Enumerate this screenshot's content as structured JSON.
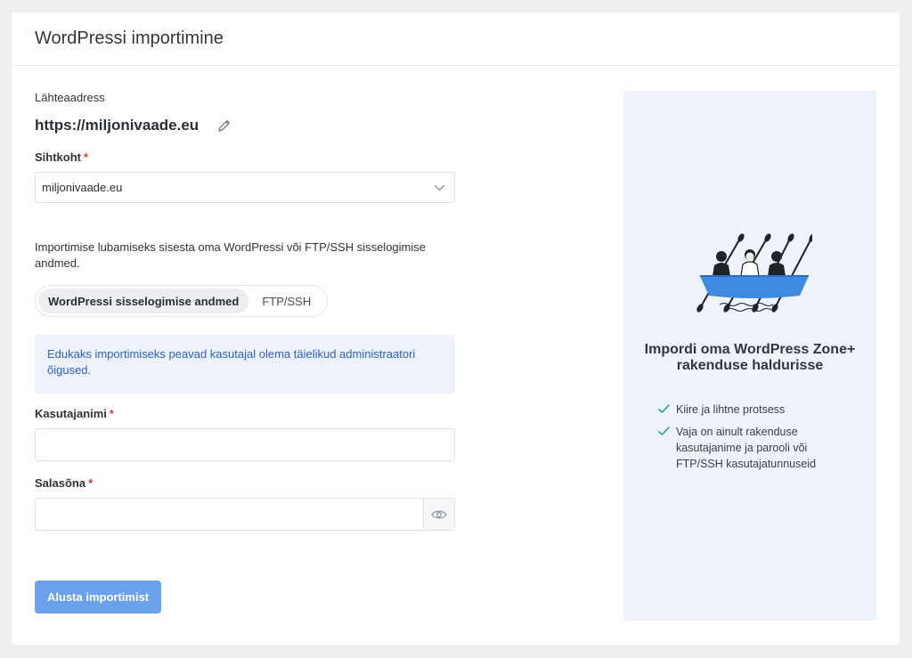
{
  "header": {
    "title": "WordPressi importimine"
  },
  "form": {
    "source_label": "Lähteaadress",
    "source_url": "https://miljonivaade.eu",
    "destination_label": "Sihtkoht",
    "destination_value": "miljonivaade.eu",
    "info_text": "Importimise lubamiseks sisesta oma WordPressi või FTP/SSH sisselogimise andmed.",
    "tabs": [
      {
        "label": "WordPressi sisselogimise andmed",
        "active": true
      },
      {
        "label": "FTP/SSH",
        "active": false
      }
    ],
    "notice": "Edukaks importimiseks peavad kasutajal olema täielikud administraatori õigused.",
    "username_label": "Kasutajanimi",
    "username_value": "",
    "password_label": "Salasõna",
    "password_value": "",
    "required_mark": "*",
    "submit_label": "Alusta importimist"
  },
  "side": {
    "title": "Impordi oma WordPress Zone+ rakenduse haldurisse",
    "features": [
      "Kiire ja lihtne protsess",
      "Vaja on ainult rakenduse kasutajanime ja parooli või FTP/SSH kasutajatunnuseid"
    ]
  },
  "colors": {
    "accent": "#6aa0ec",
    "notice_text": "#2d5fc4",
    "notice_bg": "#edf2fb",
    "required": "#d63b3b",
    "check": "#2aa37a",
    "boat": "#3d8ae0"
  }
}
